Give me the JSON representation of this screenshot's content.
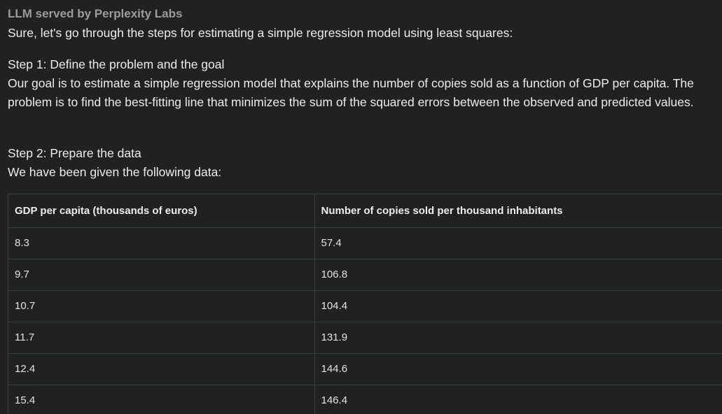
{
  "source_label": "LLM served by Perplexity Labs",
  "intro": "Sure, let's go through the steps for estimating a simple regression model using least squares:",
  "step1": {
    "title": "Step 1: Define the problem and the goal",
    "body": "Our goal is to estimate a simple regression model that explains the number of copies sold as a function of GDP per capita. The problem is to find the best-fitting line that minimizes the sum of the squared errors between the observed and predicted values."
  },
  "step2": {
    "title": "Step 2: Prepare the data",
    "body": "We have been given the following data:"
  },
  "table": {
    "headers": [
      "GDP per capita (thousands of euros)",
      "Number of copies sold per thousand inhabitants"
    ],
    "rows": [
      [
        "8.3",
        "57.4"
      ],
      [
        "9.7",
        "106.8"
      ],
      [
        "10.7",
        "104.4"
      ],
      [
        "11.7",
        "131.9"
      ],
      [
        "12.4",
        "144.6"
      ],
      [
        "15.4",
        "146.4"
      ]
    ]
  },
  "colors": {
    "background": "#202222",
    "text": "#ececea",
    "muted": "#9b9d9c",
    "border": "#3a3d3d"
  }
}
